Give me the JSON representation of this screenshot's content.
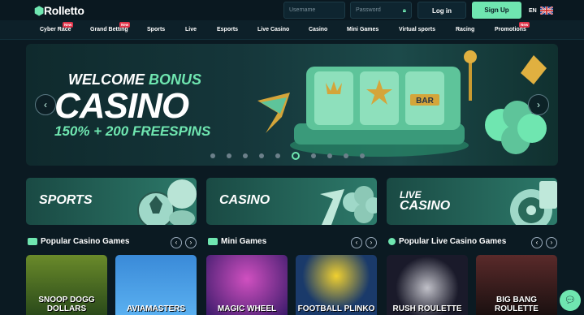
{
  "header": {
    "logo": "Rolletto",
    "username_placeholder": "Username",
    "password_placeholder": "Password",
    "login": "Log in",
    "signup": "Sign Up",
    "lang": "EN"
  },
  "nav": {
    "items": [
      {
        "label": "Cyber Race",
        "new": "New"
      },
      {
        "label": "Grand Betting",
        "new": "New"
      },
      {
        "label": "Sports",
        "new": ""
      },
      {
        "label": "Live",
        "new": ""
      },
      {
        "label": "Esports",
        "new": ""
      },
      {
        "label": "Live Casino",
        "new": ""
      },
      {
        "label": "Casino",
        "new": ""
      },
      {
        "label": "Mini Games",
        "new": ""
      },
      {
        "label": "Virtual sports",
        "new": ""
      },
      {
        "label": "Racing",
        "new": ""
      },
      {
        "label": "Promotions",
        "new": "New"
      }
    ]
  },
  "banner": {
    "line1a": "WELCOME",
    "line1b": "BONUS",
    "line2": "CASINO",
    "line3": "150% + 200 FREESPINS",
    "reel_label": "BAR",
    "prev": "‹",
    "next": "›"
  },
  "categories": {
    "sports": "SPORTS",
    "casino": "CASINO",
    "live_top": "LIVE",
    "live_bottom": "CASINO"
  },
  "sections": {
    "casino": "Popular Casino Games",
    "mini": "Mini Games",
    "live": "Popular Live Casino Games",
    "prev": "‹",
    "next": "›"
  },
  "games": [
    {
      "title": "SNOOP DOGG DOLLARS"
    },
    {
      "title": "AVIAMASTERS"
    },
    {
      "title": "MAGIC WHEEL"
    },
    {
      "title": "FOOTBALL PLINKO"
    },
    {
      "title": "RUSH ROULETTE"
    },
    {
      "title": "BIG BANG ROULETTE"
    }
  ],
  "colors": {
    "accent": "#6fe6b0",
    "bg": "#0b1a22",
    "badge": "#e0344a"
  }
}
